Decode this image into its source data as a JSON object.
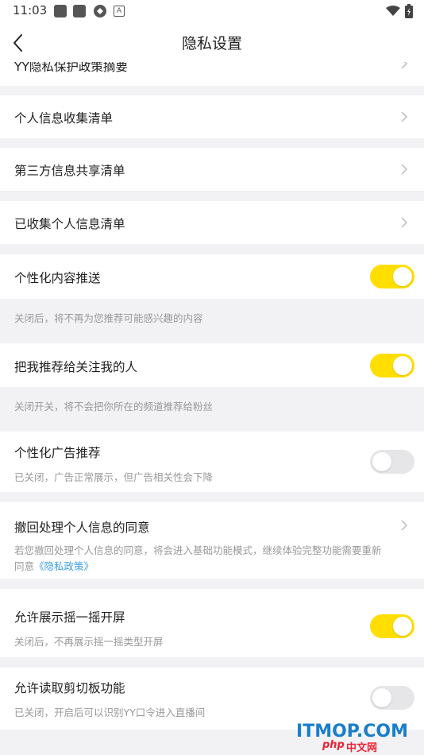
{
  "status_bar": {
    "time": "11:03"
  },
  "header": {
    "title": "隐私设置"
  },
  "rows": {
    "policy_summary": "YY隐私保护政策摘要",
    "personal_info_list": "个人信息收集清单",
    "third_party_list": "第三方信息共享清单",
    "collected_list": "已收集个人信息清单",
    "personalized_content": {
      "label": "个性化内容推送",
      "on": true,
      "note": "关闭后，将不再为您推荐可能感兴趣的内容"
    },
    "recommend_to_followers": {
      "label": "把我推荐给关注我的人",
      "on": true,
      "note": "关闭开关，将不会把你所在的频道推荐给粉丝"
    },
    "personalized_ads": {
      "label": "个性化广告推荐",
      "on": false,
      "sub": "已关闭，广告正常展示，但广告相关性会下降"
    },
    "revoke_consent": {
      "label": "撤回处理个人信息的同意",
      "sub_line1": "若您撤回处理个人信息的同意，将会进入基础功能模式，继续体验完整功能需要重新",
      "sub_line2_prefix": "同意",
      "policy_link": "《隐私政策》"
    },
    "shake_screen": {
      "label": "允许展示摇一摇开屏",
      "on": true,
      "sub": "关闭后，不再展示摇一摇类型开屏"
    },
    "clipboard": {
      "label": "允许读取剪切板功能",
      "on": false,
      "sub": "已关闭，开启后可以识别YY口令进入直播间"
    }
  },
  "watermark": {
    "brand": "ITMOP.COM",
    "php": "php",
    "cn": "中文网"
  },
  "colors": {
    "toggle_on": "#ffde00",
    "toggle_off": "#e6e6e8",
    "link": "#3aa0e6"
  }
}
